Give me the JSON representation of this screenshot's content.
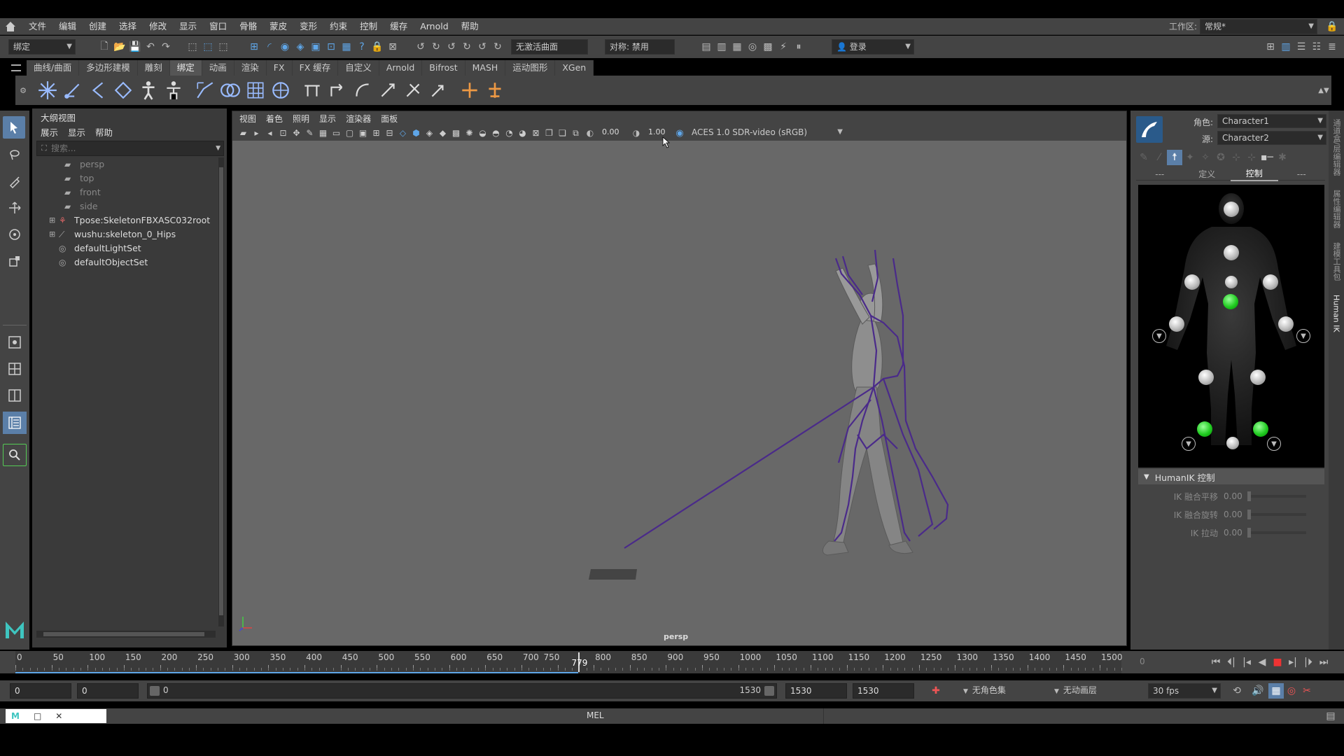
{
  "menubar": {
    "items": [
      "文件",
      "编辑",
      "创建",
      "选择",
      "修改",
      "显示",
      "窗口",
      "骨骼",
      "蒙皮",
      "变形",
      "约束",
      "控制",
      "缓存",
      "Arnold",
      "帮助"
    ],
    "workspace_label": "工作区:",
    "workspace_value": "常规*"
  },
  "toolbar": {
    "mode": "绑定",
    "live_surface": "无激活曲面",
    "symmetry": "对称: 禁用",
    "login": "登录"
  },
  "tabs": [
    "曲线/曲面",
    "多边形建模",
    "雕刻",
    "绑定",
    "动画",
    "渲染",
    "FX",
    "FX 缓存",
    "自定义",
    "Arnold",
    "Bifrost",
    "MASH",
    "运动图形",
    "XGen"
  ],
  "active_tab": 3,
  "outliner": {
    "title": "大纲视图",
    "menu": [
      "展示",
      "显示",
      "帮助"
    ],
    "search_placeholder": "搜索...",
    "items": [
      {
        "label": "persp",
        "type": "camera",
        "dim": true
      },
      {
        "label": "top",
        "type": "camera",
        "dim": true
      },
      {
        "label": "front",
        "type": "camera",
        "dim": true
      },
      {
        "label": "side",
        "type": "camera",
        "dim": true
      },
      {
        "label": "Tpose:SkeletonFBXASC032root",
        "type": "skeleton",
        "dim": false
      },
      {
        "label": "wushu:skeleton_0_Hips",
        "type": "joint",
        "dim": false
      },
      {
        "label": "defaultLightSet",
        "type": "set",
        "dim": false
      },
      {
        "label": "defaultObjectSet",
        "type": "set",
        "dim": false
      }
    ]
  },
  "viewport": {
    "menu": [
      "视图",
      "着色",
      "照明",
      "显示",
      "渲染器",
      "面板"
    ],
    "exposure": "0.00",
    "gamma": "1.00",
    "colorspace": "ACES 1.0 SDR-video (sRGB)",
    "camera_label": "persp"
  },
  "humanik": {
    "character_label": "角色:",
    "character_value": "Character1",
    "source_label": "源:",
    "source_value": "Character2",
    "tabs": [
      "---",
      "定义",
      "控制",
      "---"
    ],
    "active_tab": 2,
    "section_title": "HumanIK 控制",
    "props": [
      {
        "label": "IK 融合平移",
        "value": "0.00"
      },
      {
        "label": "IK 融合旋转",
        "value": "0.00"
      },
      {
        "label": "IK 拉动",
        "value": "0.00"
      }
    ]
  },
  "sidetabs": [
    "通道盒/层编辑器",
    "属性编辑器",
    "建模工具包",
    "Human IK"
  ],
  "timeline": {
    "ticks": [
      "0",
      "50",
      "100",
      "150",
      "200",
      "250",
      "300",
      "350",
      "400",
      "450",
      "500",
      "550",
      "600",
      "650",
      "700",
      "750",
      "800",
      "850",
      "900",
      "950",
      "1000",
      "1050",
      "1100",
      "1150",
      "1200",
      "1250",
      "1300",
      "1350",
      "1400",
      "1450",
      "1500"
    ],
    "current_frame": "779",
    "current_value": 779,
    "max": 1530,
    "frame_field": "0"
  },
  "range": {
    "start": "0",
    "anim_start": "0",
    "slider_start": "0",
    "slider_end": "1530",
    "end": "1530",
    "anim_end": "1530",
    "char_set": "无角色集",
    "anim_layer": "无动画层",
    "fps": "30 fps"
  },
  "status": {
    "mel_label": "MEL"
  },
  "colors": {
    "accent": "#5fa6e8",
    "green": "#44dd44",
    "skeleton": "#4a2a8a"
  }
}
